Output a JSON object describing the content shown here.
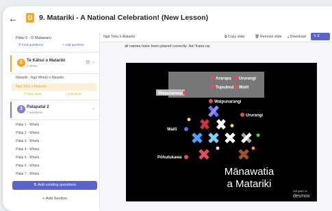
{
  "header": {
    "back_icon": "arrow-left-icon",
    "badge": "D",
    "title": "9. Matariki - A National Celebration! (New Lesson)"
  },
  "sidebar": {
    "top_item": "Pātai 5 - Ō Matawaru",
    "find_questions": "Find questions",
    "add_question": "Add question",
    "section1": {
      "number": "2",
      "title": "Te Kāhui o Matariki",
      "count": "2 slides",
      "items": [
        "Matariki - Ngā Whetū o Matariki",
        "Ngā Tohu o Matariki"
      ],
      "new_slide": "New slide",
      "add_slide": "Add slide"
    },
    "section2": {
      "number": "3",
      "title": "Patapatai 2",
      "count": "7 questions",
      "items": [
        "Pātai 1 - Whetū",
        "Pātai 2 - Whetū",
        "Pātai 3 - Whetū",
        "Pātai 4 - Whetū",
        "Pātai 5 - Whetū",
        "Pātai 6 - Whetū",
        "Pātai 7 - Whetū"
      ]
    },
    "add_existing": "Add existing questions",
    "add_section": "+ Add Section"
  },
  "toolbar": {
    "breadcrumb": "Ngā Tohu o Matariki",
    "copy_slide": "Copy slide",
    "remove_slide": "Remove slide",
    "download": "Download",
    "share": "E"
  },
  "content": {
    "cut_text": "all names have been placed correctly. Ha! Kana rai.",
    "slide": {
      "box_labels": [
        "Ararapa",
        "Ururangi",
        "Tupuānuku",
        "Waitī",
        "Waipunarangi"
      ],
      "star_labels": [
        "Waipunarangi",
        "Ururangi",
        "Waitī",
        "Pōhutukawa"
      ],
      "heading_line1": "Mānawatia",
      "heading_line2": "a Matariki",
      "brand_small": "split graph on",
      "brand": "desmos"
    }
  },
  "colors": {
    "accent": "#5b63cf",
    "badge": "#f5a623",
    "selected_row": "#fdf0d9",
    "selected_text": "#f5a623",
    "section1_circle": "#f5a623",
    "section2_circle": "#8a78c9"
  }
}
